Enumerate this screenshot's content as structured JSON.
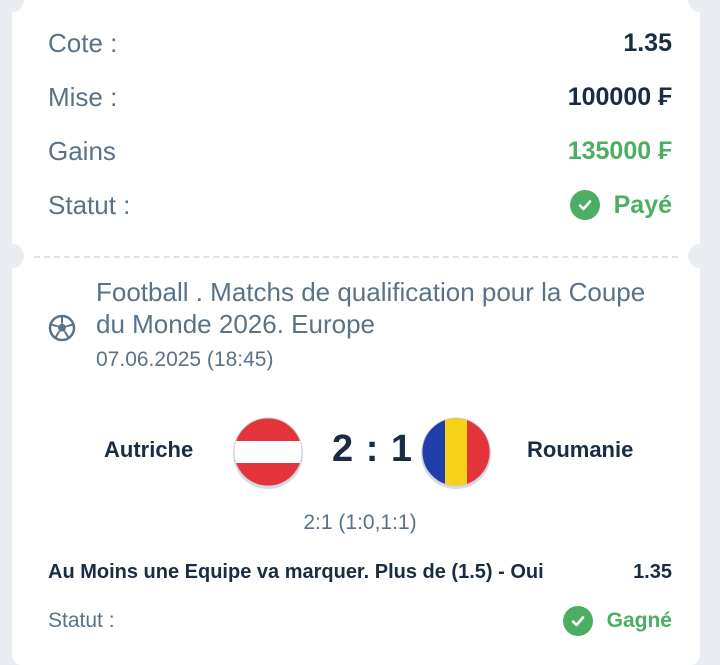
{
  "summary": {
    "cote_label": "Cote :",
    "cote_value": "1.35",
    "mise_label": "Mise :",
    "mise_value": "100000 ₣",
    "gains_label": "Gains",
    "gains_value": "135000 ₣",
    "statut_label": "Statut :",
    "statut_value": "Payé"
  },
  "event": {
    "title": "Football . Matchs de qualification pour la Coupe du Monde 2026. Europe",
    "datetime": "07.06.2025 (18:45)",
    "icon": "soccer-ball-icon"
  },
  "match": {
    "home_team": "Autriche",
    "away_team": "Roumanie",
    "score": "2 : 1",
    "detailed_score": "2:1 (1:0,1:1)",
    "home_flag": "austria-flag-icon",
    "away_flag": "romania-flag-icon"
  },
  "bet": {
    "market": "Au Moins une Equipe va marquer. Plus de (1.5) - Oui",
    "odds": "1.35",
    "statut_label": "Statut :",
    "statut_value": "Gagné"
  },
  "colors": {
    "accent_green": "#4cae62",
    "label_gray": "#5a7288",
    "text_dark": "#1a2b44",
    "background": "#e9edf2"
  }
}
